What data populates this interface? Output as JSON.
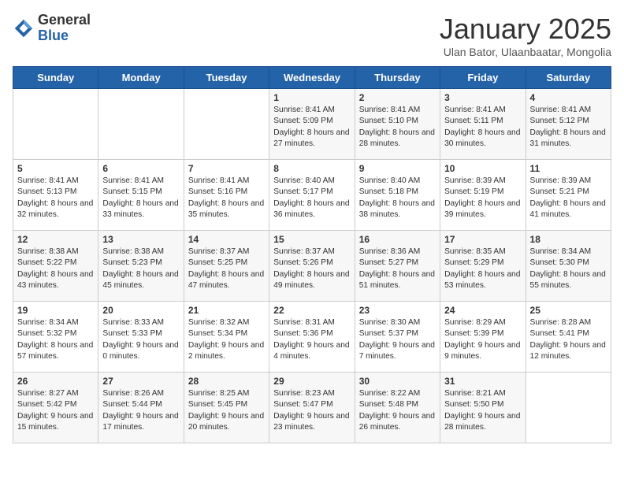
{
  "header": {
    "logo_general": "General",
    "logo_blue": "Blue",
    "month_title": "January 2025",
    "subtitle": "Ulan Bator, Ulaanbaatar, Mongolia"
  },
  "days_of_week": [
    "Sunday",
    "Monday",
    "Tuesday",
    "Wednesday",
    "Thursday",
    "Friday",
    "Saturday"
  ],
  "weeks": [
    [
      {
        "day": "",
        "info": ""
      },
      {
        "day": "",
        "info": ""
      },
      {
        "day": "",
        "info": ""
      },
      {
        "day": "1",
        "info": "Sunrise: 8:41 AM\nSunset: 5:09 PM\nDaylight: 8 hours and 27 minutes."
      },
      {
        "day": "2",
        "info": "Sunrise: 8:41 AM\nSunset: 5:10 PM\nDaylight: 8 hours and 28 minutes."
      },
      {
        "day": "3",
        "info": "Sunrise: 8:41 AM\nSunset: 5:11 PM\nDaylight: 8 hours and 30 minutes."
      },
      {
        "day": "4",
        "info": "Sunrise: 8:41 AM\nSunset: 5:12 PM\nDaylight: 8 hours and 31 minutes."
      }
    ],
    [
      {
        "day": "5",
        "info": "Sunrise: 8:41 AM\nSunset: 5:13 PM\nDaylight: 8 hours and 32 minutes."
      },
      {
        "day": "6",
        "info": "Sunrise: 8:41 AM\nSunset: 5:15 PM\nDaylight: 8 hours and 33 minutes."
      },
      {
        "day": "7",
        "info": "Sunrise: 8:41 AM\nSunset: 5:16 PM\nDaylight: 8 hours and 35 minutes."
      },
      {
        "day": "8",
        "info": "Sunrise: 8:40 AM\nSunset: 5:17 PM\nDaylight: 8 hours and 36 minutes."
      },
      {
        "day": "9",
        "info": "Sunrise: 8:40 AM\nSunset: 5:18 PM\nDaylight: 8 hours and 38 minutes."
      },
      {
        "day": "10",
        "info": "Sunrise: 8:39 AM\nSunset: 5:19 PM\nDaylight: 8 hours and 39 minutes."
      },
      {
        "day": "11",
        "info": "Sunrise: 8:39 AM\nSunset: 5:21 PM\nDaylight: 8 hours and 41 minutes."
      }
    ],
    [
      {
        "day": "12",
        "info": "Sunrise: 8:38 AM\nSunset: 5:22 PM\nDaylight: 8 hours and 43 minutes."
      },
      {
        "day": "13",
        "info": "Sunrise: 8:38 AM\nSunset: 5:23 PM\nDaylight: 8 hours and 45 minutes."
      },
      {
        "day": "14",
        "info": "Sunrise: 8:37 AM\nSunset: 5:25 PM\nDaylight: 8 hours and 47 minutes."
      },
      {
        "day": "15",
        "info": "Sunrise: 8:37 AM\nSunset: 5:26 PM\nDaylight: 8 hours and 49 minutes."
      },
      {
        "day": "16",
        "info": "Sunrise: 8:36 AM\nSunset: 5:27 PM\nDaylight: 8 hours and 51 minutes."
      },
      {
        "day": "17",
        "info": "Sunrise: 8:35 AM\nSunset: 5:29 PM\nDaylight: 8 hours and 53 minutes."
      },
      {
        "day": "18",
        "info": "Sunrise: 8:34 AM\nSunset: 5:30 PM\nDaylight: 8 hours and 55 minutes."
      }
    ],
    [
      {
        "day": "19",
        "info": "Sunrise: 8:34 AM\nSunset: 5:32 PM\nDaylight: 8 hours and 57 minutes."
      },
      {
        "day": "20",
        "info": "Sunrise: 8:33 AM\nSunset: 5:33 PM\nDaylight: 9 hours and 0 minutes."
      },
      {
        "day": "21",
        "info": "Sunrise: 8:32 AM\nSunset: 5:34 PM\nDaylight: 9 hours and 2 minutes."
      },
      {
        "day": "22",
        "info": "Sunrise: 8:31 AM\nSunset: 5:36 PM\nDaylight: 9 hours and 4 minutes."
      },
      {
        "day": "23",
        "info": "Sunrise: 8:30 AM\nSunset: 5:37 PM\nDaylight: 9 hours and 7 minutes."
      },
      {
        "day": "24",
        "info": "Sunrise: 8:29 AM\nSunset: 5:39 PM\nDaylight: 9 hours and 9 minutes."
      },
      {
        "day": "25",
        "info": "Sunrise: 8:28 AM\nSunset: 5:41 PM\nDaylight: 9 hours and 12 minutes."
      }
    ],
    [
      {
        "day": "26",
        "info": "Sunrise: 8:27 AM\nSunset: 5:42 PM\nDaylight: 9 hours and 15 minutes."
      },
      {
        "day": "27",
        "info": "Sunrise: 8:26 AM\nSunset: 5:44 PM\nDaylight: 9 hours and 17 minutes."
      },
      {
        "day": "28",
        "info": "Sunrise: 8:25 AM\nSunset: 5:45 PM\nDaylight: 9 hours and 20 minutes."
      },
      {
        "day": "29",
        "info": "Sunrise: 8:23 AM\nSunset: 5:47 PM\nDaylight: 9 hours and 23 minutes."
      },
      {
        "day": "30",
        "info": "Sunrise: 8:22 AM\nSunset: 5:48 PM\nDaylight: 9 hours and 26 minutes."
      },
      {
        "day": "31",
        "info": "Sunrise: 8:21 AM\nSunset: 5:50 PM\nDaylight: 9 hours and 28 minutes."
      },
      {
        "day": "",
        "info": ""
      }
    ]
  ]
}
